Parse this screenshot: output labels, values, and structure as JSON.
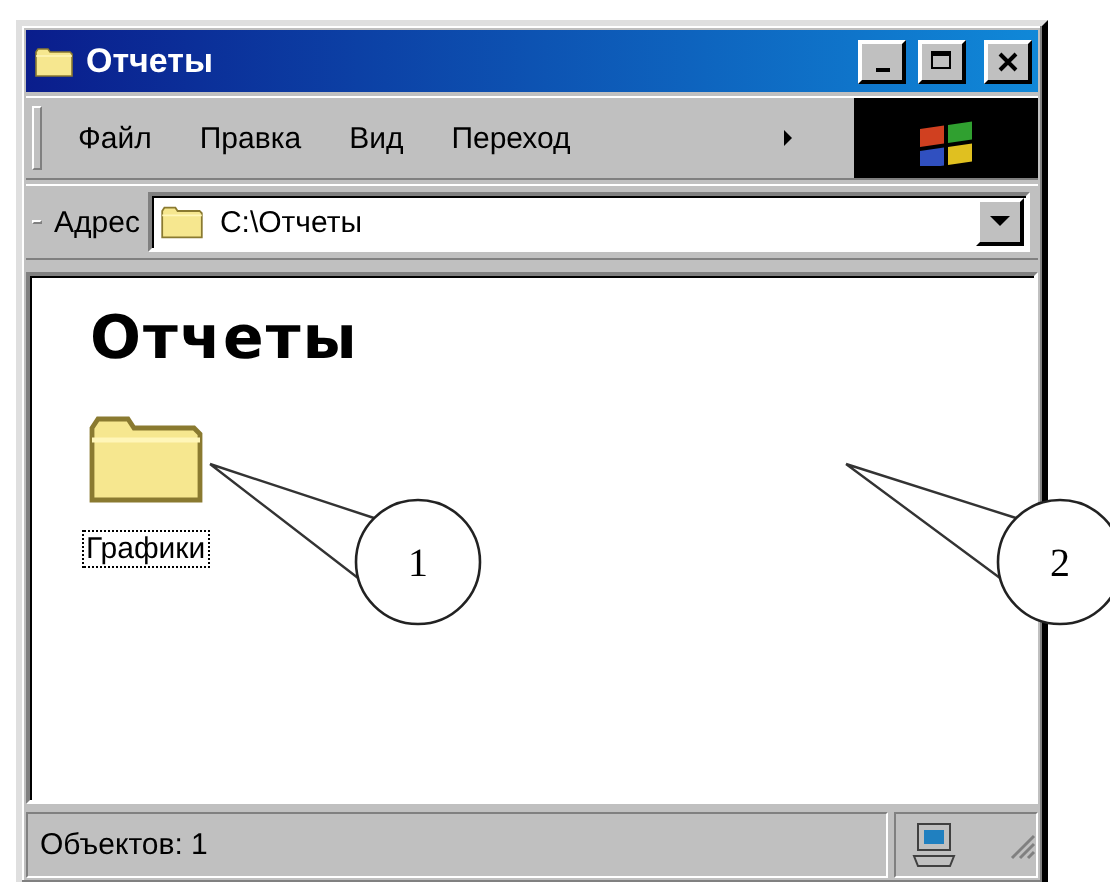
{
  "window": {
    "title": "Отчеты"
  },
  "menu": [
    {
      "label": "Файл"
    },
    {
      "label": "Правка"
    },
    {
      "label": "Вид"
    },
    {
      "label": "Переход"
    }
  ],
  "address_bar": {
    "label": "Адрес",
    "value": "C:\\Отчеты"
  },
  "content": {
    "heading": "Отчеты",
    "items": [
      {
        "label": "Графики",
        "selected": true
      }
    ]
  },
  "status_bar": {
    "text": "Объектов: 1"
  },
  "callouts": [
    {
      "label": "1"
    },
    {
      "label": "2"
    }
  ]
}
